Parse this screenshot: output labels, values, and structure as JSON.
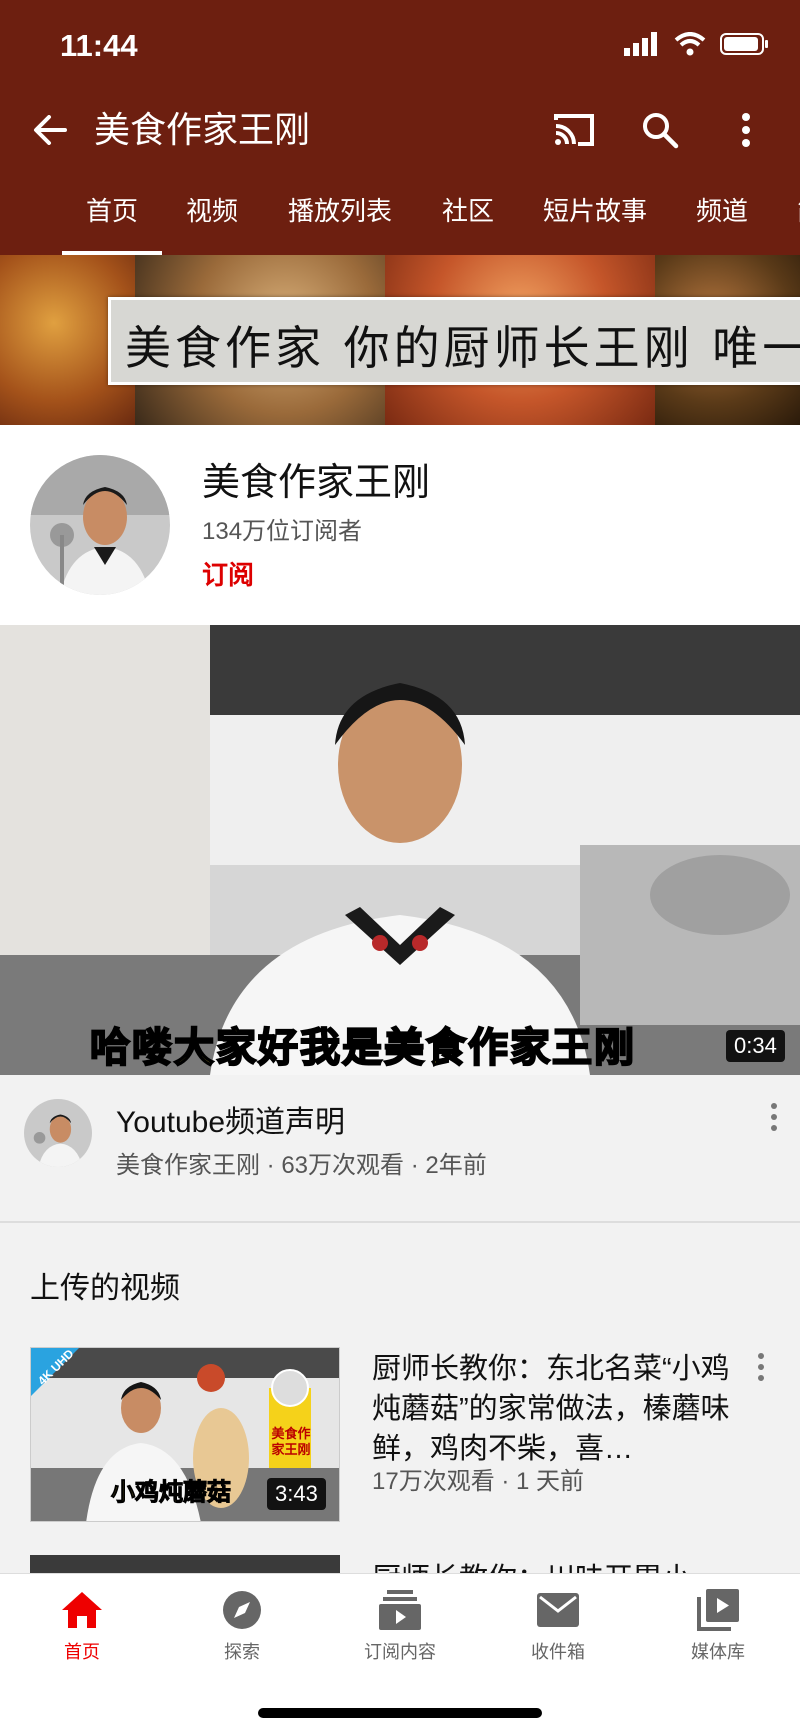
{
  "status_bar": {
    "time": "11:44"
  },
  "header": {
    "title": "美食作家王刚",
    "tabs": [
      "首页",
      "视频",
      "播放列表",
      "社区",
      "短片故事",
      "频道",
      "简"
    ]
  },
  "banner": {
    "text": "美食作家 你的厨师长王刚 唯一"
  },
  "channel": {
    "name": "美食作家王刚",
    "subscribers": "134万位订阅者",
    "subscribe_label": "订阅"
  },
  "featured": {
    "caption": "哈喽大家好我是美食作家王刚",
    "duration": "0:34",
    "title": "Youtube频道声明",
    "meta": "美食作家王刚 · 63万次观看 · 2年前"
  },
  "uploads": {
    "section_title": "上传的视频",
    "items": [
      {
        "badge": "4K UHD",
        "thumb_caption": "小鸡炖蘑菇",
        "thumb_logo": "美食作家王刚",
        "duration": "3:43",
        "title": "厨师长教你：东北名菜“小鸡炖蘑菇”的家常做法，榛蘑味鲜，鸡肉不柴，喜…",
        "meta": "17万次观看 · 1 天前"
      },
      {
        "title": "厨师长教你：川味开胃小"
      }
    ]
  },
  "bottom_nav": [
    {
      "label": "首页",
      "icon": "home-icon"
    },
    {
      "label": "探索",
      "icon": "explore-icon"
    },
    {
      "label": "订阅内容",
      "icon": "subscriptions-icon"
    },
    {
      "label": "收件箱",
      "icon": "inbox-icon"
    },
    {
      "label": "媒体库",
      "icon": "library-icon"
    }
  ],
  "colors": {
    "header_bg": "#6d1f10",
    "accent_red": "#e00000",
    "subscribe_red": "#dd0000"
  }
}
